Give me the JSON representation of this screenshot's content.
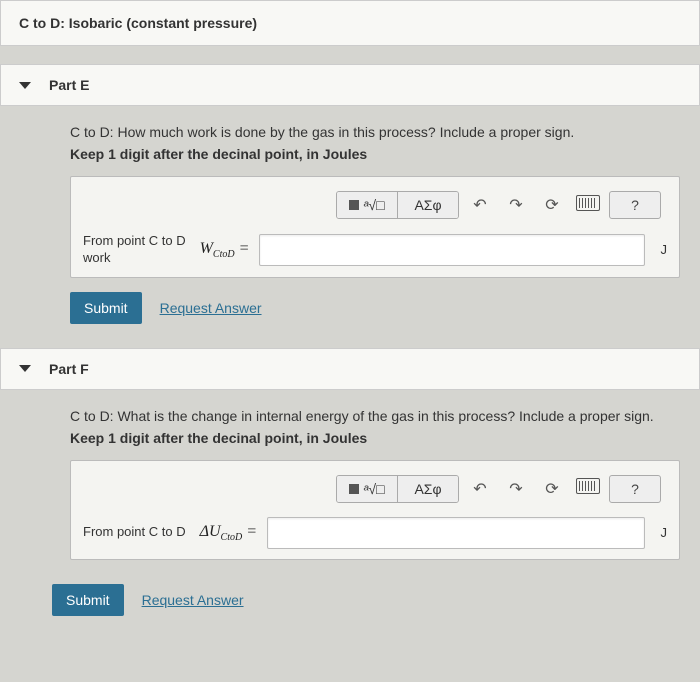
{
  "header": {
    "title": "C to D: Isobaric (constant pressure)"
  },
  "partE": {
    "label": "Part E",
    "prompt": "C to D: How much work is done by the gas in this process? Include a proper sign.",
    "instruction": "Keep 1 digit after the decinal point, in Joules",
    "inputLabelLine1": "From point C to D",
    "inputLabelLine2": "work",
    "variable": "W",
    "subscript": "CtoD",
    "equals": "=",
    "unit": "J",
    "submit": "Submit",
    "request": "Request Answer"
  },
  "partF": {
    "label": "Part F",
    "prompt": "C to D: What is the change in internal energy of the gas in this process? Include a proper sign.",
    "instruction": "Keep 1 digit after the decinal point, in Joules",
    "inputLabel": "From point C to D",
    "variablePrefix": "ΔU",
    "subscript": "CtoD",
    "equals": "=",
    "unit": "J",
    "submit": "Submit",
    "request": "Request Answer"
  },
  "toolbar": {
    "templates": "■",
    "root": "√",
    "rootBox": "□",
    "greek": "ΑΣφ",
    "undo": "↶",
    "redo": "↷",
    "reset": "⟳",
    "help": "?"
  }
}
